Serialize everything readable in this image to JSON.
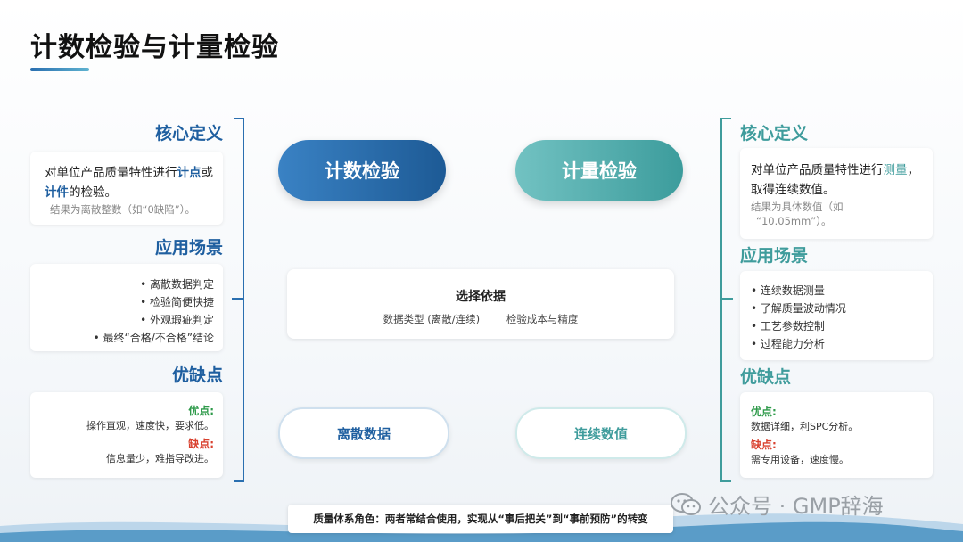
{
  "title": "计数检验与计量检验",
  "left": {
    "definition_title": "核心定义",
    "definition_line1_a": "对单位产品质量特性进行",
    "definition_line1_hl": "计点",
    "definition_line1_b": "或",
    "definition_line2_hl": "计件",
    "definition_line2_b": "的检验。",
    "definition_sub": "结果为离散整数（如“0缺陷”）。",
    "scenario_title": "应用场景",
    "scenarios": [
      "• 离散数据判定",
      "• 检验简便快捷",
      "• 外观瑕疵判定",
      "• 最终“合格/不合格”结论"
    ],
    "pc_title": "优缺点",
    "pro_label": "优点:",
    "pro_text": "操作直观，速度快，要求低。",
    "con_label": "缺点:",
    "con_text": "信息量少，难指导改进。"
  },
  "right": {
    "definition_title": "核心定义",
    "definition_line1_a": "对单位产品质量特性进行",
    "definition_line1_hl": "测量",
    "definition_line1_b": "，",
    "definition_line2": "取得连续数值。",
    "definition_sub1": "结果为具体数值（如",
    "definition_sub2": "“10.05mm”）。",
    "scenario_title": "应用场景",
    "scenarios": [
      "• 连续数据测量",
      "• 了解质量波动情况",
      "• 工艺参数控制",
      "• 过程能力分析"
    ],
    "pc_title": "优缺点",
    "pro_label": "优点:",
    "pro_text": "数据详细，利SPC分析。",
    "con_label": "缺点:",
    "con_text": "需专用设备，速度慢。"
  },
  "center": {
    "count_label": "计数检验",
    "measure_label": "计量检验",
    "basis_title": "选择依据",
    "basis_item1": "数据类型 (离散/连续)",
    "basis_item2": "检验成本与精度",
    "discrete_label": "离散数据",
    "continuous_label": "连续数值"
  },
  "footer": "质量体系角色：两者常结合使用，实现从“事后把关”到“事前预防”的转变",
  "watermark": "公众号 · GMP辞海",
  "colors": {
    "blue": "#1f5fa0",
    "teal": "#3f9c9c",
    "pro": "#2e9a4a",
    "con": "#d9412f"
  }
}
